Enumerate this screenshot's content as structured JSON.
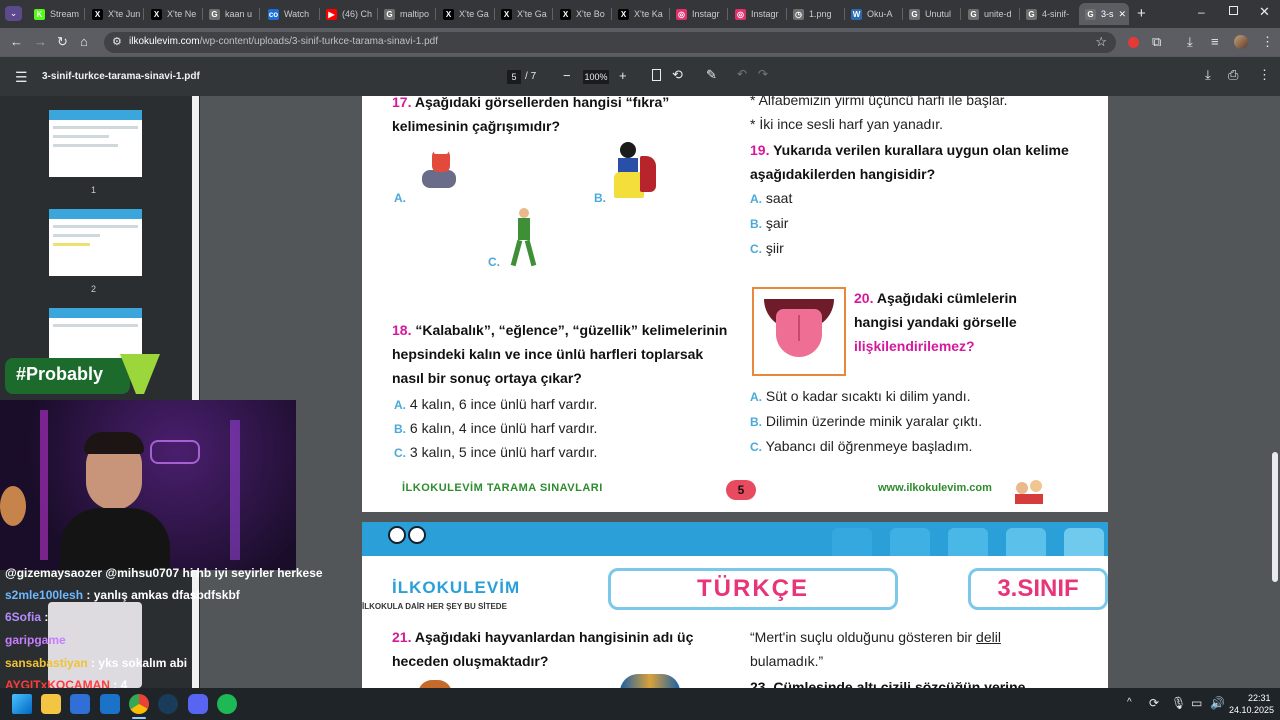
{
  "tabs": [
    {
      "label": "Stream",
      "color": "#53fc18",
      "glyph": "K"
    },
    {
      "label": "X'te Jun",
      "color": "#000000",
      "glyph": "X"
    },
    {
      "label": "X'te Ne",
      "color": "#000000",
      "glyph": "X"
    },
    {
      "label": "kaan u",
      "color": "#6f6f6f",
      "glyph": "G"
    },
    {
      "label": "Watch",
      "color": "#1b6fd6",
      "glyph": "co"
    },
    {
      "label": "(46) Ch",
      "color": "#ff0000",
      "glyph": "▶"
    },
    {
      "label": "maltipo",
      "color": "#6f6f6f",
      "glyph": "G"
    },
    {
      "label": "X'te Ga",
      "color": "#000000",
      "glyph": "X"
    },
    {
      "label": "X'te Ga",
      "color": "#000000",
      "glyph": "X"
    },
    {
      "label": "X'te Bo",
      "color": "#000000",
      "glyph": "X"
    },
    {
      "label": "X'te Ka",
      "color": "#000000",
      "glyph": "X"
    },
    {
      "label": "Instagr",
      "color": "#e1306c",
      "glyph": "◎"
    },
    {
      "label": "Instagr",
      "color": "#e1306c",
      "glyph": "◎"
    },
    {
      "label": "1.png",
      "color": "#6f6f6f",
      "glyph": "◷"
    },
    {
      "label": "Oku-A",
      "color": "#2b6cb0",
      "glyph": "W"
    },
    {
      "label": "Unutul",
      "color": "#6f6f6f",
      "glyph": "G"
    },
    {
      "label": "unite-d",
      "color": "#6f6f6f",
      "glyph": "G"
    },
    {
      "label": "4-sinif-",
      "color": "#6f6f6f",
      "glyph": "G"
    },
    {
      "label": "3-s",
      "color": "#6f6f6f",
      "glyph": "G",
      "active": true
    }
  ],
  "address": {
    "domain": "ilkokulevim.com",
    "path": "/wp-content/uploads/3-sinif-turkce-tarama-sinavi-1.pdf"
  },
  "pdf": {
    "filename": "3-sinif-turkce-tarama-sinavi-1.pdf",
    "page_current": "5",
    "page_total": "7",
    "zoom": "100%"
  },
  "thumbs": [
    {
      "label": "1"
    },
    {
      "label": "2"
    },
    {
      "label": "3"
    }
  ],
  "overlay": {
    "probably": "#Probably"
  },
  "page5": {
    "q17_num": "17.",
    "q17_text1": "Aşağıdaki görsellerden hangisi “fıkra”",
    "q17_text2": "kelimesinin çağrışımıdır?",
    "q17_optA": "A.",
    "q17_optB": "B.",
    "q17_optC": "C.",
    "q18_num": "18.",
    "q18_text1": "“Kalabalık”, “eğlence”, “güzellik” kelimelerinin",
    "q18_text2": "hepsindeki kalın ve ince ünlü harfleri toplarsak",
    "q18_text3": "nasıl bir sonuç ortaya çıkar?",
    "q18_options": [
      {
        "label": "A.",
        "text": "4 kalın, 6 ince ünlü harf vardır."
      },
      {
        "label": "B.",
        "text": "6 kalın, 4 ince ünlü harf vardır."
      },
      {
        "label": "C.",
        "text": "3 kalın, 5 ince ünlü harf vardır."
      }
    ],
    "rule1": "* Alfabemizin yirmi üçüncü harfi ile başlar.",
    "rule2": "* İki ince sesli harf yan yanadır.",
    "q19_num": "19.",
    "q19_text1": "Yukarıda verilen kurallara uygun olan kelime",
    "q19_text2": "aşağıdakilerden hangisidir?",
    "q19_options": [
      {
        "label": "A.",
        "text": "saat"
      },
      {
        "label": "B.",
        "text": "şair"
      },
      {
        "label": "C.",
        "text": "şiir"
      }
    ],
    "q20_num": "20.",
    "q20_text1": "Aşağıdaki cümlelerin",
    "q20_text2": "hangisi yandaki görselle",
    "q20_text3": "ilişkilendirilemez?",
    "q20_options": [
      {
        "label": "A.",
        "text": "Süt o kadar sıcaktı ki dilim yandı."
      },
      {
        "label": "B.",
        "text": "Dilimin üzerinde minik yaralar çıktı."
      },
      {
        "label": "C.",
        "text": "Yabancı dil öğrenmeye başladım."
      }
    ],
    "footer_left": "İLKOKULEVİM TARAMA SINAVLARI",
    "footer_page": "5",
    "footer_right": "www.ilkokulevim.com"
  },
  "page6": {
    "brand": "İLKOKULEVİM",
    "tagline": "İLKOKULA DAİR HER ŞEY BU SİTEDE",
    "subject": "TÜRKÇE",
    "grade": "3.SINIF",
    "q21_num": "21.",
    "q21_text1": "Aşağıdaki hayvanlardan hangisinin adı üç",
    "q21_text2": "heceden oluşmaktadır?",
    "quote1": "“Mert'in suçlu olduğunu gösteren bir",
    "quote_underlined": "delil",
    "quote2": "bulamadık.”",
    "q23_partial": "23. Cümlesinde altı çizili sözcüğün yerine"
  },
  "chat": [
    {
      "user": "@gizemaysaozer @mihsu0707",
      "msg": "hi hb iyi seyirler herkese",
      "color": "#ffffff"
    },
    {
      "user": "s2mle100lesh",
      "msg": ": yanlış amkas dfasbdfskbf",
      "color": "#6fb7ff"
    },
    {
      "user": "6Sofia",
      "msg": ":",
      "color": "#b48cff"
    },
    {
      "user": "garipgame",
      "msg": "",
      "color": "#c77dff"
    },
    {
      "user": "sansabastiyan",
      "msg": ": yks sokalım abi",
      "color": "#f1c232"
    },
    {
      "user": "AYGITxKOCAMAN",
      "msg": ": 4",
      "color": "#ff3b3b"
    }
  ],
  "clock": {
    "time": "22:31",
    "date": "24.10.2025"
  }
}
